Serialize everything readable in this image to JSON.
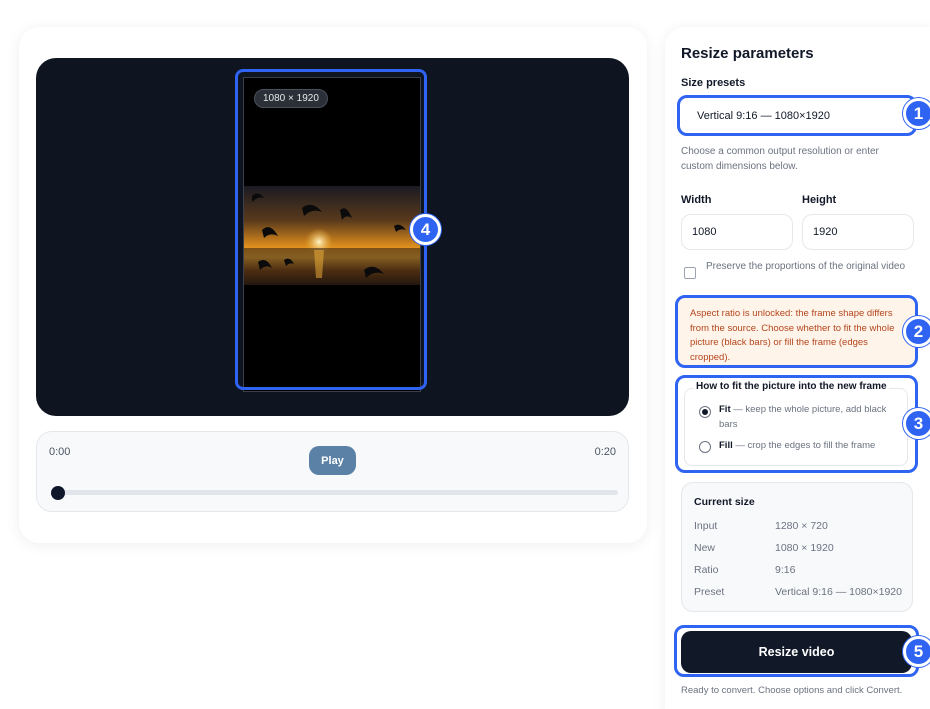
{
  "preview": {
    "frame_dimensions": "1080 × 1920",
    "time_start": "0:00",
    "time_end": "0:20",
    "play_label": "Play",
    "progress": 0
  },
  "panel": {
    "title": "Resize parameters",
    "size_presets_label": "Size presets",
    "size_preset_value": "Vertical 9:16 — 1080×1920",
    "help_text": "Choose a common output resolution or enter custom dimensions below.",
    "width_label": "Width",
    "width_value": "1080",
    "height_label": "Height",
    "height_value": "1920",
    "preserve_label": "Preserve the proportions of the original video",
    "preserve_checked": false,
    "warning": "Aspect ratio is unlocked: the frame shape differs from the source. Choose whether to fit the whole picture (black bars) or fill the frame (edges cropped).",
    "fit_legend": "How to fit the picture into the new frame",
    "fit_options": [
      {
        "name": "Fit",
        "desc": " — keep the whole picture, add black bars",
        "selected": true
      },
      {
        "name": "Fill",
        "desc": " — crop the edges to fill the frame",
        "selected": false
      }
    ],
    "current_size": {
      "title": "Current size",
      "rows": [
        {
          "key": "Input",
          "value": "1280 × 720"
        },
        {
          "key": "New",
          "value": "1080 × 1920"
        },
        {
          "key": "Ratio",
          "value": "9:16"
        },
        {
          "key": "Preset",
          "value": "Vertical 9:16 — 1080×1920"
        }
      ]
    },
    "resize_button": "Resize video",
    "status": "Ready to convert. Choose options and click Convert."
  },
  "annotations": [
    "1",
    "2",
    "3",
    "4",
    "5"
  ],
  "colors": {
    "highlight": "#2f63f2",
    "stage": "#0e1420",
    "warning_text": "#b4451c",
    "warning_bg": "#fff4ea",
    "primary_button": "#111827",
    "play_button": "#5b82a6"
  }
}
